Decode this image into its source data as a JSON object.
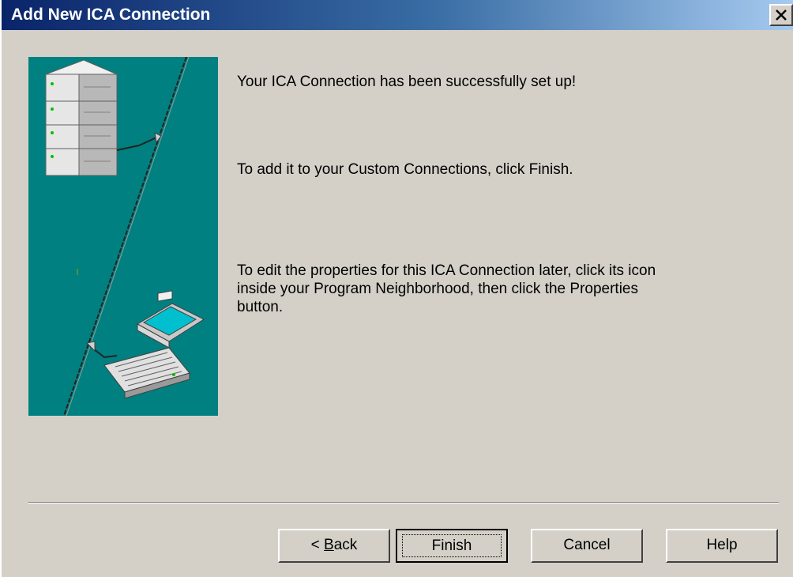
{
  "window": {
    "title": "Add New ICA Connection",
    "close_label": "close"
  },
  "content": {
    "line1": "Your ICA Connection has been successfully set up!",
    "line2": "To add it to your Custom Connections, click Finish.",
    "line3": "To edit the properties for this ICA Connection later, click its icon inside your Program Neighborhood, then click the Properties button."
  },
  "buttons": {
    "back_prefix": "< ",
    "back_key": "B",
    "back_rest": "ack",
    "finish": "Finish",
    "cancel": "Cancel",
    "help": "Help"
  },
  "illustration": {
    "icons": [
      "server-stack-icon",
      "laptop-icon"
    ],
    "background_color": "#008080"
  }
}
